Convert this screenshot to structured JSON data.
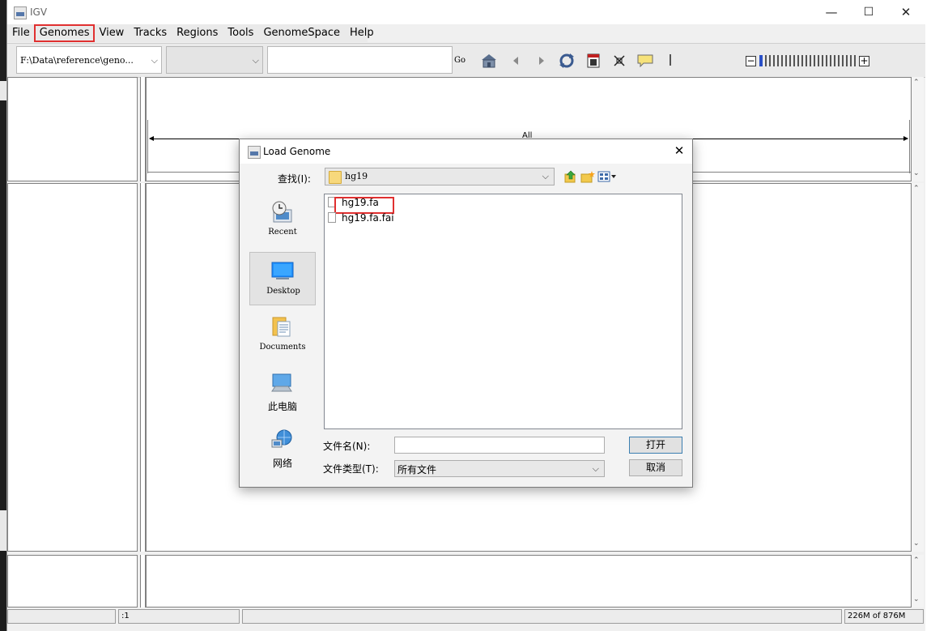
{
  "window": {
    "title": "IGV",
    "controls": {
      "minimize": "—",
      "maximize": "☐",
      "close": "✕"
    }
  },
  "menu": {
    "items": [
      "File",
      "Genomes",
      "View",
      "Tracks",
      "Regions",
      "Tools",
      "GenomeSpace",
      "Help"
    ],
    "highlighted": "Genomes"
  },
  "toolbar": {
    "genome_combo": "F:\\Data\\reference\\geno...",
    "chromosome_combo": "",
    "locus_input": "",
    "go_label": "Go",
    "icons": [
      "home-icon",
      "back-icon",
      "forward-icon",
      "refresh-icon",
      "ruler-icon",
      "resize-icon",
      "popup-text-icon",
      "separator-icon"
    ],
    "zoom": {
      "minus": "−",
      "plus": "+",
      "ticks": 24,
      "level": 0
    }
  },
  "ruler": {
    "label": "All"
  },
  "status": {
    "left": "",
    "locus": ":1",
    "middle": "",
    "memory": "226M of 876M"
  },
  "dialog": {
    "title": "Load Genome",
    "close": "✕",
    "look_in_label": "查找(I):",
    "look_in_value": "hg19",
    "places": [
      {
        "label": "Recent",
        "icon": "recent-icon"
      },
      {
        "label": "Desktop",
        "icon": "desktop-icon"
      },
      {
        "label": "Documents",
        "icon": "documents-icon"
      },
      {
        "label": "此电脑",
        "icon": "computer-icon"
      },
      {
        "label": "网络",
        "icon": "network-icon"
      }
    ],
    "selected_place": "Desktop",
    "files": [
      "hg19.fa",
      "hg19.fa.fai"
    ],
    "highlighted_file": "hg19.fa",
    "file_name_label": "文件名(N):",
    "file_name_value": "",
    "file_type_label": "文件类型(T):",
    "file_type_value": "所有文件",
    "open_button": "打开",
    "cancel_button": "取消"
  },
  "colors": {
    "highlight": "#e03030",
    "desktop_blue": "#1e90ff",
    "folder": "#f7d87c"
  }
}
